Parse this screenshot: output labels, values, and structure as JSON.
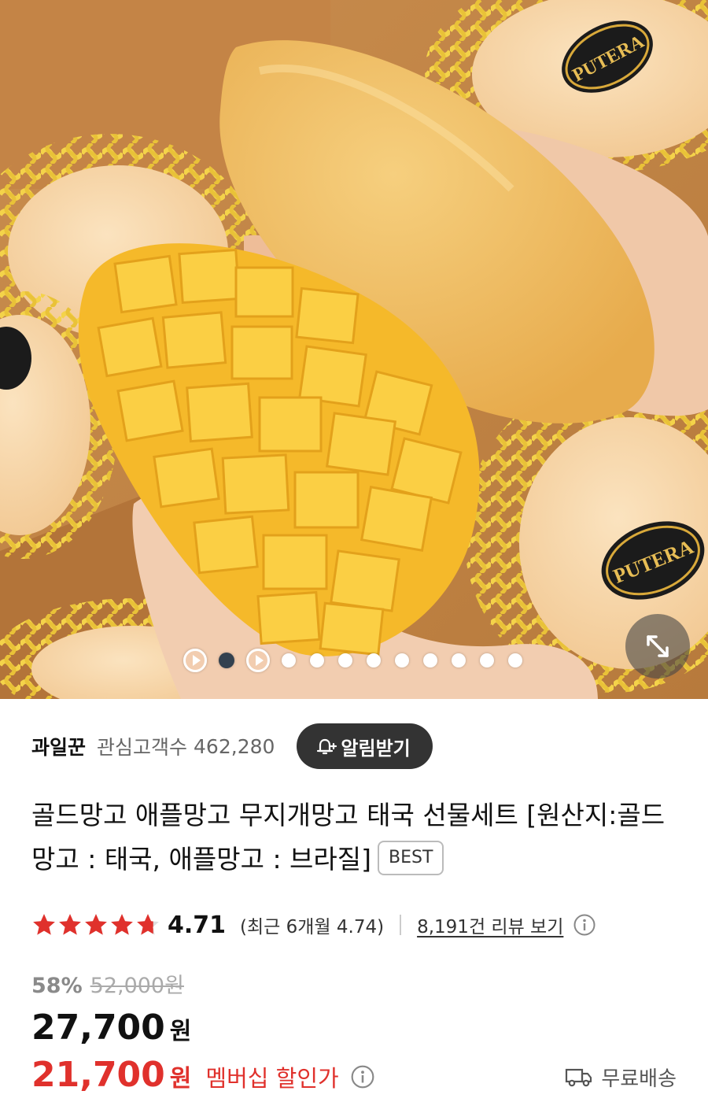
{
  "hero": {
    "label_text": "PUTERA",
    "carousel_total": 12,
    "carousel_active_index": 1
  },
  "seller": {
    "name": "과일꾼",
    "followers_label": "관심고객수",
    "followers_count": "462,280",
    "alarm_button": "알림받기"
  },
  "product": {
    "title": "골드망고 애플망고 무지개망고 태국 선물세트 [원산지:골드망고 : 태국, 애플망고 : 브라질]",
    "badge": "BEST"
  },
  "rating": {
    "value": "4.71",
    "stars": 4.71,
    "recent": "(최근 6개월 4.74)",
    "review_link": "8,191건 리뷰 보기"
  },
  "pricing": {
    "discount_percent": "58%",
    "original_price": "52,000원",
    "price": "27,700",
    "price_unit": "원",
    "member_price": "21,700",
    "member_unit": "원",
    "member_label": "멤버십 할인가"
  },
  "shipping": {
    "label": "무료배송"
  },
  "colors": {
    "accent_red": "#e0312c",
    "star_red": "#e0312c",
    "button_dark": "#333333"
  },
  "icons": [
    "play-icon",
    "expand-icon",
    "bell-plus-icon",
    "star-icon",
    "info-icon",
    "truck-icon"
  ]
}
